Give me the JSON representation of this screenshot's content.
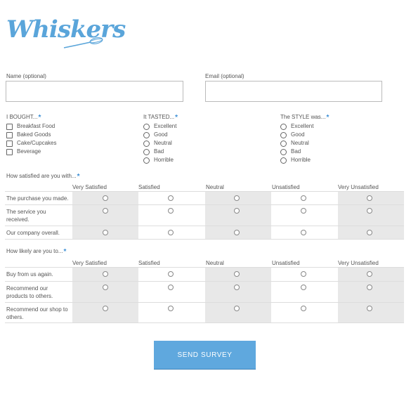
{
  "brand": {
    "name": "Whiskers",
    "logo_icon": "whisk-icon",
    "color": "#5aa5da"
  },
  "fields": {
    "name": {
      "label": "Name (optional)",
      "value": "",
      "placeholder": ""
    },
    "email": {
      "label": "Email (optional)",
      "value": "",
      "placeholder": ""
    }
  },
  "bought": {
    "title": "I BOUGHT...",
    "options": [
      "Breakfast Food",
      "Baked Goods",
      "Cake/Cupcakes",
      "Beverage"
    ]
  },
  "tasted": {
    "title": "It TASTED...",
    "options": [
      "Excellent",
      "Good",
      "Neutral",
      "Bad",
      "Horrible"
    ]
  },
  "style": {
    "title": "The STYLE was...",
    "options": [
      "Excellent",
      "Good",
      "Neutral",
      "Bad",
      "Horrible"
    ]
  },
  "required_mark": "*",
  "satisfaction": {
    "title": "How satisfied are you with...",
    "columns": [
      "Very Satisfied",
      "Satisfied",
      "Neutral",
      "Unsatisfied",
      "Very Unsatisfied"
    ],
    "rows": [
      "The purchase you made.",
      "The service you received.",
      "Our company overall."
    ]
  },
  "likelihood": {
    "title": "How likely are you to...",
    "columns": [
      "Very Satisfied",
      "Satisfied",
      "Neutral",
      "Unsatisfied",
      "Very Unsatisfied"
    ],
    "rows": [
      "Buy from us again.",
      "Recommend our products to others.",
      "Recommend our shop to others."
    ]
  },
  "submit": {
    "label": "SEND SURVEY",
    "color": "#5fa8de"
  }
}
